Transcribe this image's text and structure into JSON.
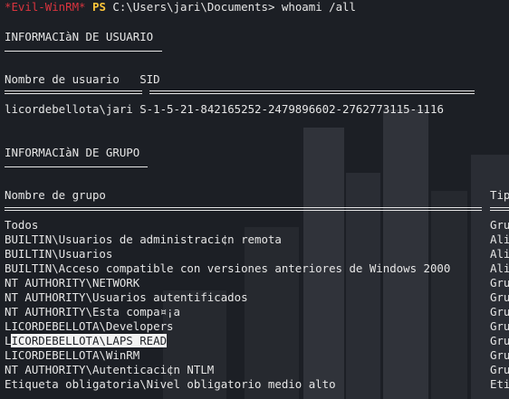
{
  "prompt": {
    "host": "*Evil-WinRM*",
    "shell": "PS",
    "path": "C:\\Users\\jari\\Documents>",
    "command": "whoami /all"
  },
  "user_section": {
    "title": "INFORMACIàN DE USUARIO",
    "col_user": "Nombre de usuario",
    "col_sid": "SID",
    "user": "licordebellota\\jari",
    "sid": "S-1-5-21-842165252-2479896602-2762773115-1116"
  },
  "group_section": {
    "title": "INFORMACIàN DE GRUPO",
    "col_group": "Nombre de grupo",
    "col_type": "Tip",
    "rows": [
      {
        "name": "Todos",
        "type": "Gru"
      },
      {
        "name": "BUILTIN\\Usuarios de administraci¢n remota",
        "type": "Ali"
      },
      {
        "name": "BUILTIN\\Usuarios",
        "type": "Ali"
      },
      {
        "name": "BUILTIN\\Acceso compatible con versiones anteriores de Windows 2000",
        "type": "Ali"
      },
      {
        "name": "NT AUTHORITY\\NETWORK",
        "type": "Gru"
      },
      {
        "name": "NT AUTHORITY\\Usuarios autentificados",
        "type": "Gru"
      },
      {
        "name": "NT AUTHORITY\\Esta compa¤¡a",
        "type": "Gru"
      },
      {
        "name": "LICORDEBELLOTA\\Developers",
        "type": "Gru"
      },
      {
        "name_plain": "L",
        "name_selected": "ICORDEBELLOTA\\LAPS READ",
        "type": "Gru"
      },
      {
        "name": "LICORDEBELLOTA\\WinRM",
        "type": "Gru"
      },
      {
        "name": "NT AUTHORITY\\Autenticaci¢n NTLM",
        "type": "Gru"
      },
      {
        "name": "Etiqueta obligatoria\\Nivel obligatorio medio alto",
        "type": "Etiq"
      }
    ]
  }
}
